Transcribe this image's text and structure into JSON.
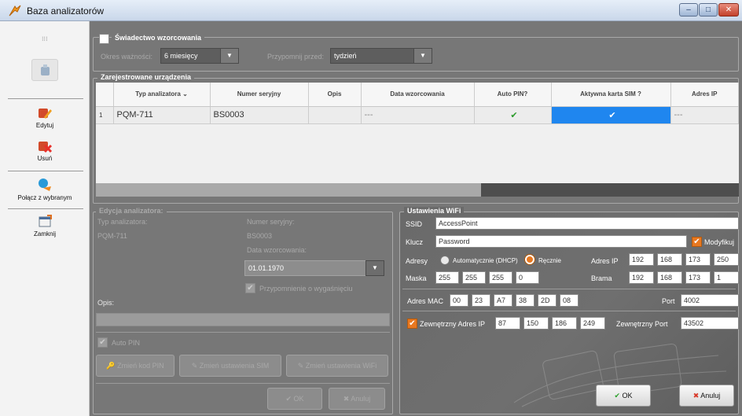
{
  "window": {
    "title": "Baza analizatorów",
    "min": "–",
    "max": "□",
    "close": "✕"
  },
  "sidebar": {
    "items": [
      {
        "label": "Edytuj"
      },
      {
        "label": "Usuń"
      },
      {
        "label": "Połącz z wybranym"
      },
      {
        "label": "Zamknij"
      }
    ]
  },
  "cert": {
    "title": "Świadectwo wzorcowania",
    "validity_label": "Okres ważności:",
    "validity_value": "6 miesięcy",
    "remind_label": "Przypomnij przed:",
    "remind_value": "tydzień"
  },
  "devices": {
    "title": "Zarejestrowane urządzenia",
    "columns": [
      "Typ analizatora",
      "Numer seryjny",
      "Opis",
      "Data wzorcowania",
      "Auto PIN?",
      "Aktywna karta SIM ?",
      "Adres IP"
    ],
    "rows": [
      {
        "num": "1",
        "type": "PQM-711",
        "serial": "BS0003",
        "desc": "",
        "date": "---",
        "autopin": "✔",
        "sim": "✔",
        "ip": "---"
      }
    ]
  },
  "edit": {
    "title": "Edycja analizatora:",
    "type_label": "Typ analizatora:",
    "type_value": "PQM-711",
    "serial_label": "Numer seryjny:",
    "serial_value": "BS0003",
    "date_label": "Data wzorcowania:",
    "date_value": "01.01.1970",
    "reminder_label": "Przypomnienie o wygaśnięciu",
    "desc_label": "Opis:",
    "desc_value": "",
    "autopin_label": "Auto PIN",
    "btn_pin": "Zmień kod PIN",
    "btn_sim": "Zmień ustawienia SIM",
    "btn_wifi": "Zmień ustawienia WiFi",
    "btn_ok": "OK",
    "btn_cancel": "Anuluj"
  },
  "wifi": {
    "title": "Ustawienia WiFi",
    "ssid_label": "SSID",
    "ssid_value": "AccessPoint",
    "key_label": "Klucz",
    "key_value": "Password",
    "modify_label": "Modyfikuj",
    "addr_label": "Adresy",
    "dhcp_label": "Automatycznie (DHCP)",
    "manual_label": "Ręcznie",
    "ip_label": "Adres IP",
    "ip": [
      "192",
      "168",
      "173",
      "250"
    ],
    "mask_label": "Maska",
    "mask": [
      "255",
      "255",
      "255",
      "0"
    ],
    "gw_label": "Brama",
    "gw": [
      "192",
      "168",
      "173",
      "1"
    ],
    "mac_label": "Adres MAC",
    "mac": [
      "00",
      "23",
      "A7",
      "38",
      "2D",
      "08"
    ],
    "port_label": "Port",
    "port_value": "4002",
    "ext_ip_label": "Zewnętrzny Adres IP",
    "ext_ip": [
      "87",
      "150",
      "186",
      "249"
    ],
    "ext_port_label": "Zewnętrzny Port",
    "ext_port_value": "43502",
    "ok": "OK",
    "cancel": "Anuluj"
  }
}
